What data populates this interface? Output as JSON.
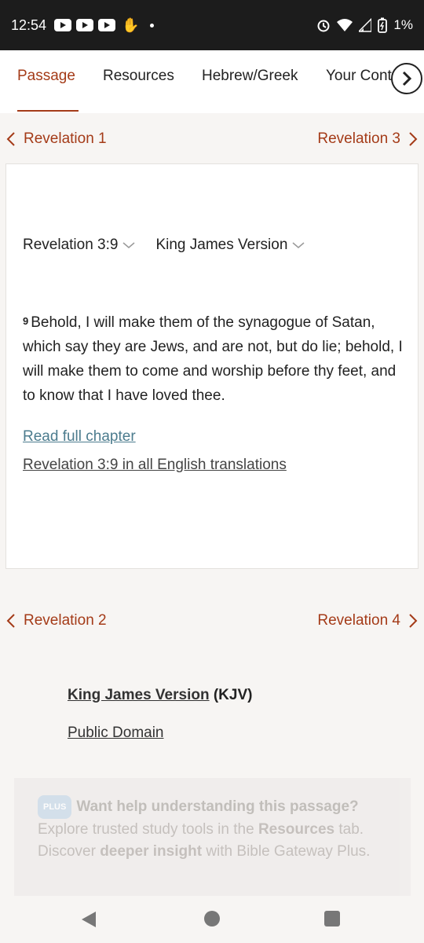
{
  "status_bar": {
    "time": "12:54",
    "icons": [
      "youtube-icon",
      "youtube-icon",
      "youtube-icon",
      "hand-icon",
      "dot-icon",
      "alarm-icon",
      "wifi-icon",
      "signal-icon",
      "battery-icon"
    ],
    "battery": "1%"
  },
  "tabs": [
    {
      "label": "Passage"
    },
    {
      "label": "Resources"
    },
    {
      "label": "Hebrew/Greek"
    },
    {
      "label": "Your Cont"
    }
  ],
  "chapter_nav_top": {
    "prev": "Revelation 1",
    "next": "Revelation 3"
  },
  "passage": {
    "reference": "Revelation 3:9",
    "version": "King James Version",
    "verse_number": "9",
    "verse_text": "Behold, I will make them of the synagogue of Satan, which say they are Jews, and are not, but do lie; behold, I will make them to come and worship before thy feet, and to know that I have loved thee.",
    "read_full": "Read full chapter",
    "all_translations": "Revelation 3:9 in all English translations"
  },
  "chapter_nav_bottom": {
    "prev": "Revelation 2",
    "next": "Revelation 4"
  },
  "version_info": {
    "name": "King James Version",
    "abbr": "(KJV)",
    "copyright": "Public Domain"
  },
  "plus_promo": {
    "badge": "PLUS",
    "heading": "Want help understanding this passage?",
    "text1": "Explore trusted study tools in the",
    "bold1": "Resources",
    "text2": "tab. Discover",
    "bold2": "deeper insight",
    "text3": "with Bible Gateway Plus."
  },
  "colors": {
    "accent": "#a43b18",
    "link_teal": "#4c7c8e",
    "status_bg": "#1c1c1c"
  }
}
